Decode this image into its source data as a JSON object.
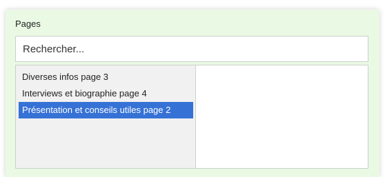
{
  "panel": {
    "title": "Pages",
    "background": "#eaf9e4"
  },
  "search": {
    "placeholder": "Rechercher..."
  },
  "available_list": {
    "items": [
      {
        "label": "Diverses infos page 3",
        "selected": false
      },
      {
        "label": "Interviews et biographie page 4",
        "selected": false
      },
      {
        "label": "Présentation et conseils utiles page 2",
        "selected": true
      }
    ],
    "selected_color": "#3672d6"
  },
  "chosen_list": {
    "items": []
  }
}
